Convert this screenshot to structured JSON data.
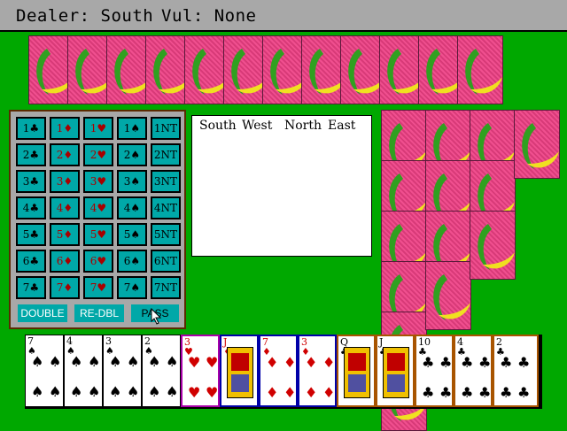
{
  "header": {
    "dealer": "Dealer: South",
    "vul": "Vul: None"
  },
  "colors": {
    "table": "#00a800",
    "panel": "#a8a8a8",
    "button": "#00a8a8",
    "card_back": "#f04f8f"
  },
  "bidding_box": {
    "rows": [
      [
        "1♣",
        "1♦",
        "1♥",
        "1♠",
        "1NT"
      ],
      [
        "2♣",
        "2♦",
        "2♥",
        "2♠",
        "2NT"
      ],
      [
        "3♣",
        "3♦",
        "3♥",
        "3♠",
        "3NT"
      ],
      [
        "4♣",
        "4♦",
        "4♥",
        "4♠",
        "4NT"
      ],
      [
        "5♣",
        "5♦",
        "5♥",
        "5♠",
        "5NT"
      ],
      [
        "6♣",
        "6♦",
        "6♥",
        "6♠",
        "6NT"
      ],
      [
        "7♣",
        "7♦",
        "7♥",
        "7♠",
        "7NT"
      ]
    ],
    "actions": {
      "double": "DOUBLE",
      "redouble": "RE-DBL",
      "pass": "PASS"
    }
  },
  "auction": {
    "columns": [
      "South",
      "West",
      "North",
      "East"
    ]
  },
  "north_hand_count": 12,
  "east_hand_columns": [
    6,
    4,
    3,
    1
  ],
  "south_hand": [
    {
      "rank": "7",
      "suit": "♠",
      "color": "blk",
      "border": "none",
      "face": false
    },
    {
      "rank": "4",
      "suit": "♠",
      "color": "blk",
      "border": "none",
      "face": false
    },
    {
      "rank": "3",
      "suit": "♠",
      "color": "blk",
      "border": "none",
      "face": false
    },
    {
      "rank": "2",
      "suit": "♠",
      "color": "blk",
      "border": "none",
      "face": false
    },
    {
      "rank": "3",
      "suit": "♥",
      "color": "red",
      "border": "purple",
      "face": false
    },
    {
      "rank": "J",
      "suit": "♦",
      "color": "red",
      "border": "blue",
      "face": true
    },
    {
      "rank": "7",
      "suit": "♦",
      "color": "red",
      "border": "blue",
      "face": false
    },
    {
      "rank": "3",
      "suit": "♦",
      "color": "red",
      "border": "blue",
      "face": false
    },
    {
      "rank": "Q",
      "suit": "♣",
      "color": "blk",
      "border": "brown",
      "face": true
    },
    {
      "rank": "J",
      "suit": "♣",
      "color": "blk",
      "border": "brown",
      "face": true
    },
    {
      "rank": "10",
      "suit": "♣",
      "color": "blk",
      "border": "brown",
      "face": false
    },
    {
      "rank": "4",
      "suit": "♣",
      "color": "blk",
      "border": "brown",
      "face": false
    },
    {
      "rank": "2",
      "suit": "♣",
      "color": "blk",
      "border": "brown",
      "face": false
    }
  ]
}
